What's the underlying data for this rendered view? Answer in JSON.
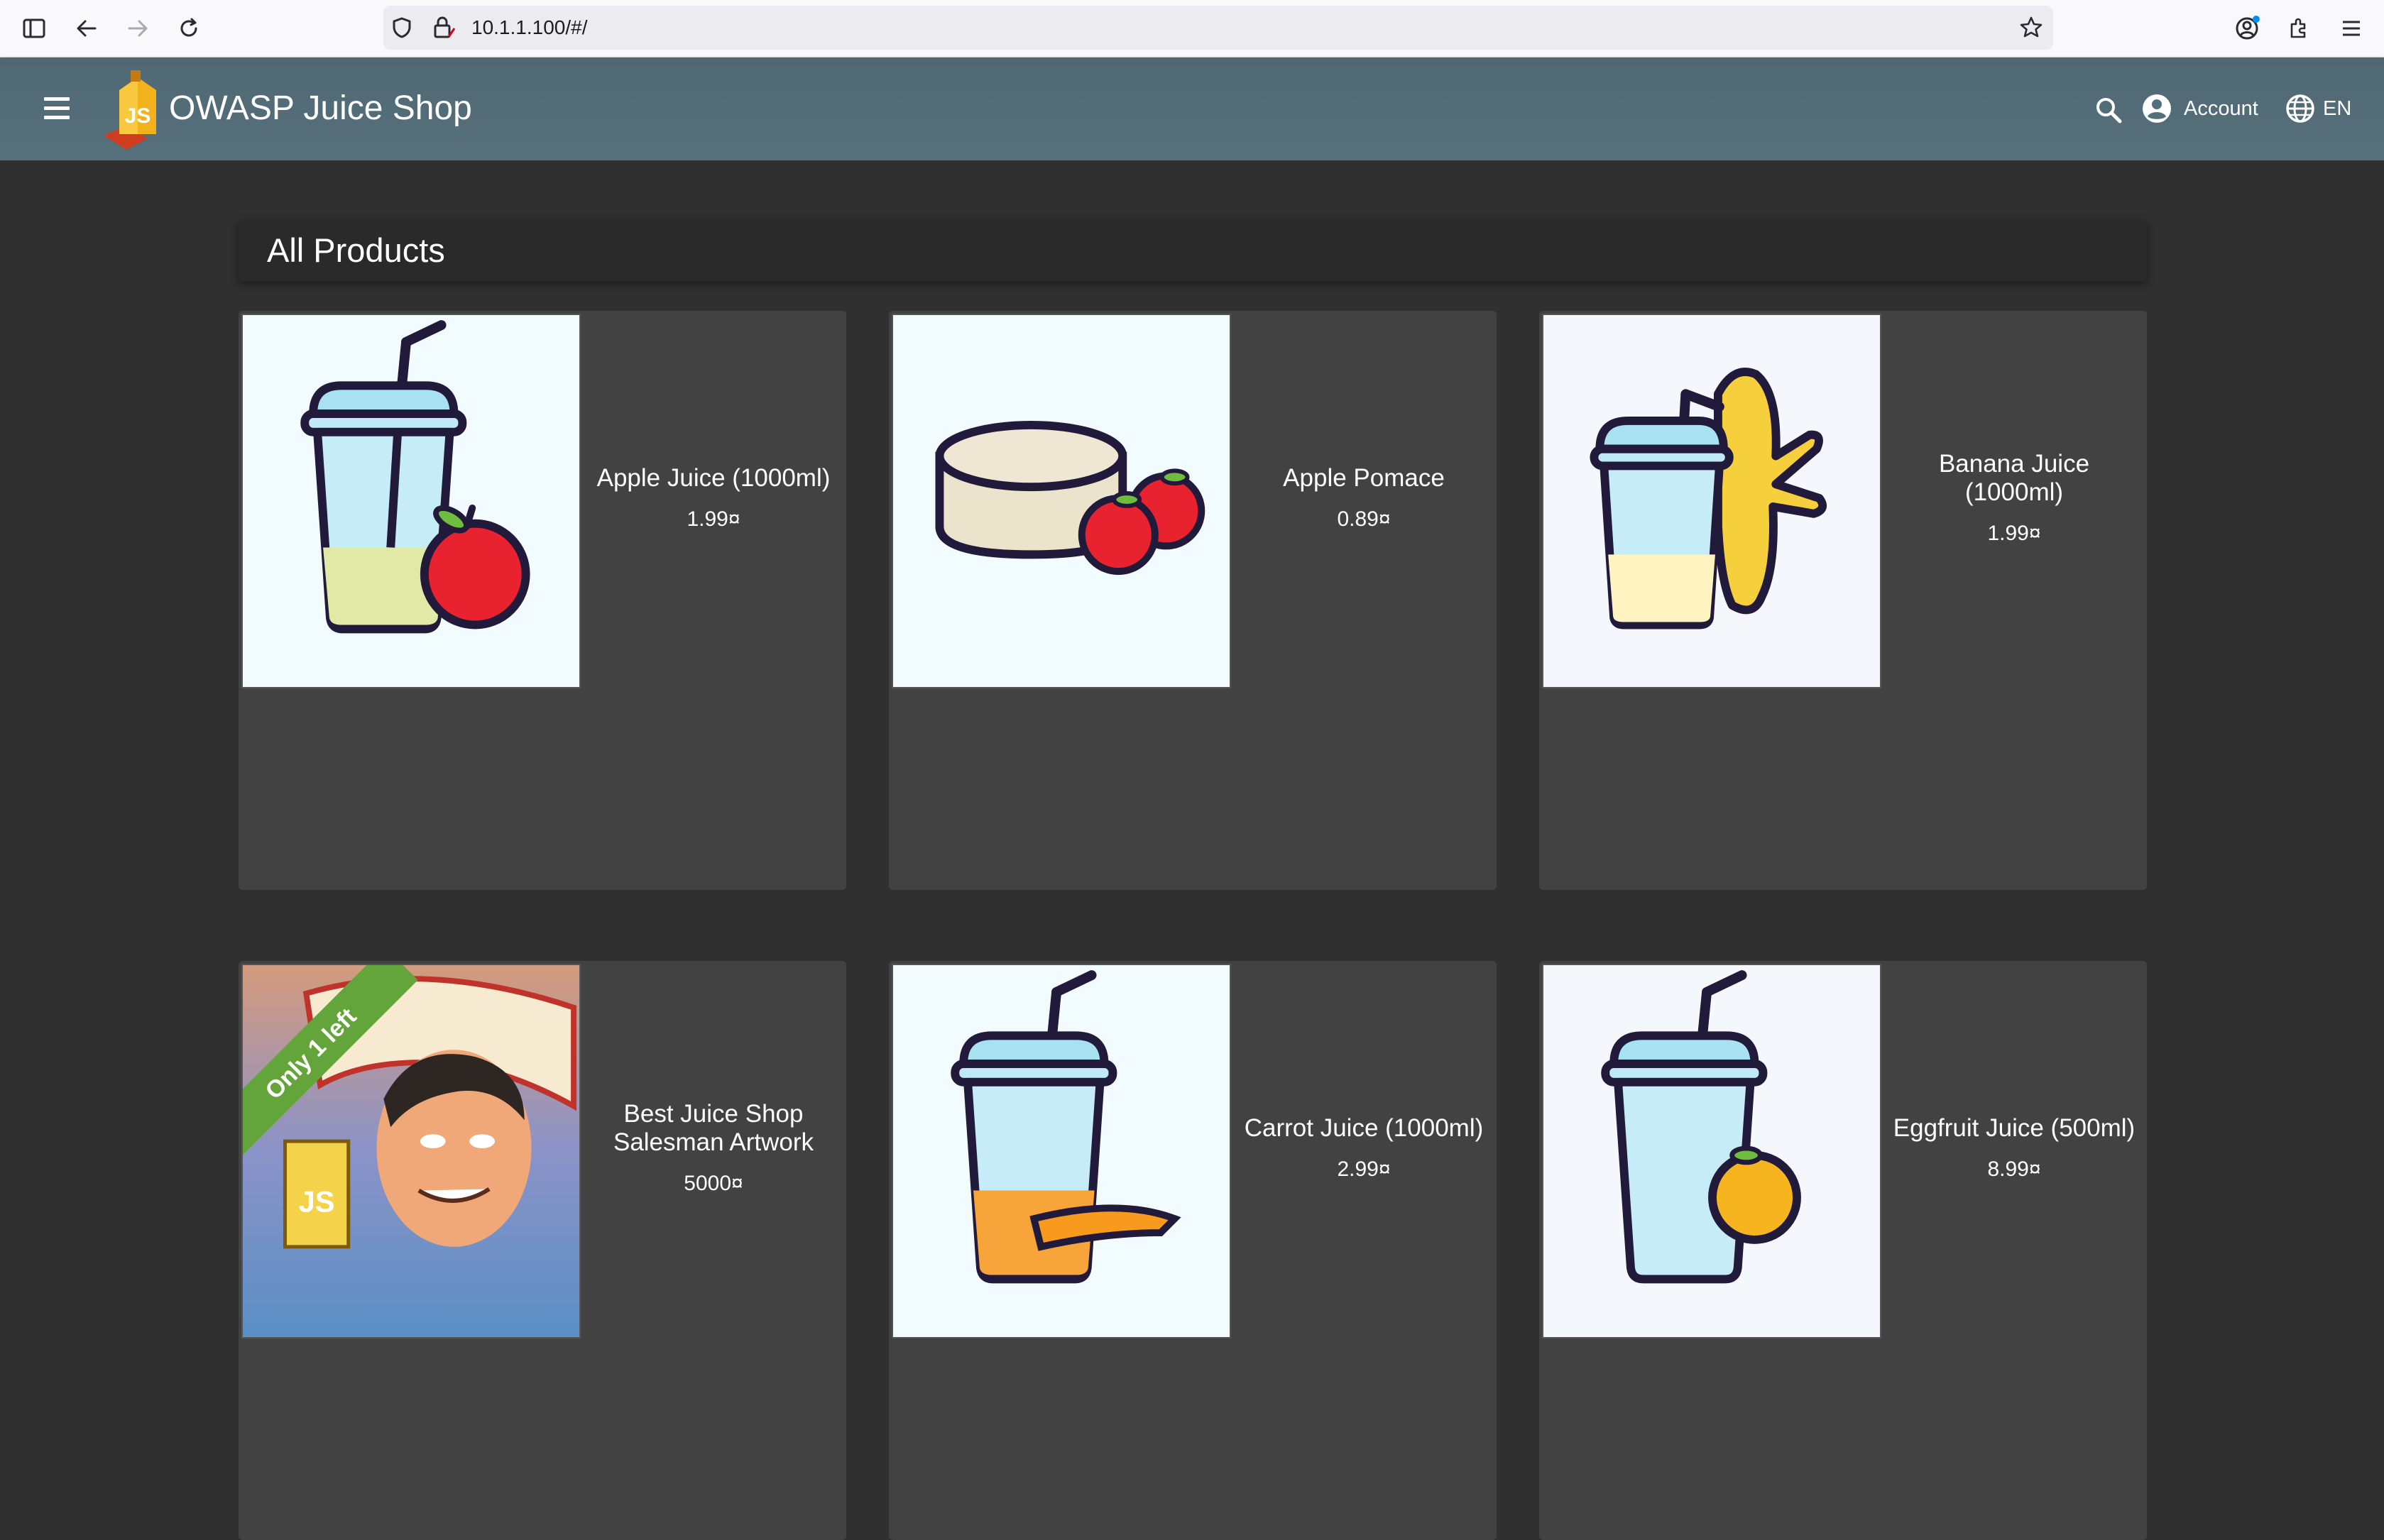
{
  "browser": {
    "url": "10.1.1.100/#/",
    "icons": [
      "sidebar-toggle-icon",
      "back-icon",
      "forward-icon",
      "reload-icon",
      "shield-icon",
      "lock-icon",
      "star-icon",
      "profile-icon",
      "extensions-icon",
      "menu-icon"
    ]
  },
  "toolbar": {
    "title": "OWASP Juice Shop",
    "account_label": "Account",
    "language_label": "EN",
    "background_color": "#546e7a"
  },
  "page": {
    "heading": "All Products"
  },
  "products": [
    {
      "name": "Apple Juice (1000ml)",
      "price": "1.99¤",
      "image": "apple-juice"
    },
    {
      "name": "Apple Pomace",
      "price": "0.89¤",
      "image": "apple-pomace"
    },
    {
      "name": "Banana Juice (1000ml)",
      "price": "1.99¤",
      "image": "banana-juice"
    },
    {
      "name": "Best Juice Shop Salesman Artwork",
      "price": "5000¤",
      "image": "salesman-artwork",
      "badge": "Only 1 left"
    },
    {
      "name": "Carrot Juice (1000ml)",
      "price": "2.99¤",
      "image": "carrot-juice"
    },
    {
      "name": "Eggfruit Juice (500ml)",
      "price": "8.99¤",
      "image": "eggfruit-juice"
    }
  ],
  "colors": {
    "background": "#303030",
    "card": "#424242",
    "badge": "#64a53b"
  }
}
